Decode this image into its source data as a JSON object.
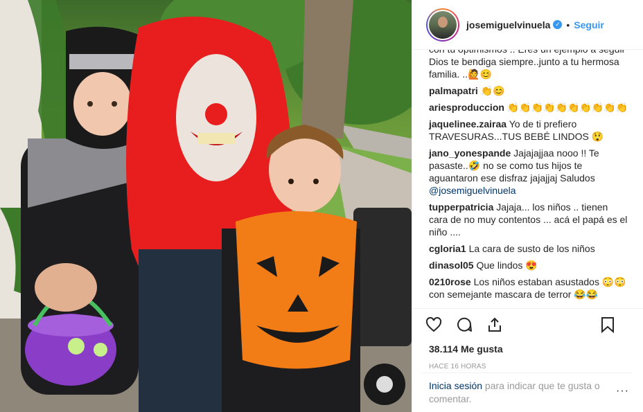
{
  "post": {
    "username": "josemiguelvinuela",
    "separator": "•",
    "follow_label": "Seguir",
    "verified_glyph": "✓",
    "likes": "38.114 Me gusta",
    "time_ago": "HACE 16 HORAS",
    "login_link": "Inicia sesión",
    "login_text": " para indicar que te gusta o comentar.",
    "more_label": "···"
  },
  "comments": [
    {
      "user": "",
      "text": "con tu optimismos .. Eres un ejemplo a seguir Dios te bendiga siempre..junto a tu hermosa familia. ..🙋😊"
    },
    {
      "user": "palmapatri",
      "text": "👏😊"
    },
    {
      "user": "ariesproduccion",
      "text": "👏👏👏👏👏👏👏👏👏👏"
    },
    {
      "user": "jaquelinee.zairaa",
      "text": "Yo de ti prefiero TRAVESURAS...TUS BEBÉ LINDOS 😲"
    },
    {
      "user": "jano_yonespande",
      "text": "Jajajajjaa nooo !! Te pasaste..🤣  no se como tus hijos te aguantaron ese disfraz jajajjaj Saludos ",
      "mention": "@josemiguelvinuela"
    },
    {
      "user": "tupperpatricia",
      "text": "Jajaja... los niños .. tienen cara de no muy contentos ... acá el papá es el niño ...."
    },
    {
      "user": "cgloria1",
      "text": "La cara de susto de los niños"
    },
    {
      "user": "dinasol05",
      "text": "Que lindos 😍"
    },
    {
      "user": "0210rose",
      "text": "Los niños estaban asustados 😳😳 con semejante mascara de terror 😂😂"
    }
  ],
  "icons": {
    "like": "heart-icon",
    "comment": "comment-icon",
    "share": "share-icon",
    "save": "bookmark-icon",
    "verified": "verified-badge-icon"
  },
  "colors": {
    "link": "#3897f0",
    "username_dark": "#262626",
    "muted": "#999999",
    "mention": "#003569"
  }
}
